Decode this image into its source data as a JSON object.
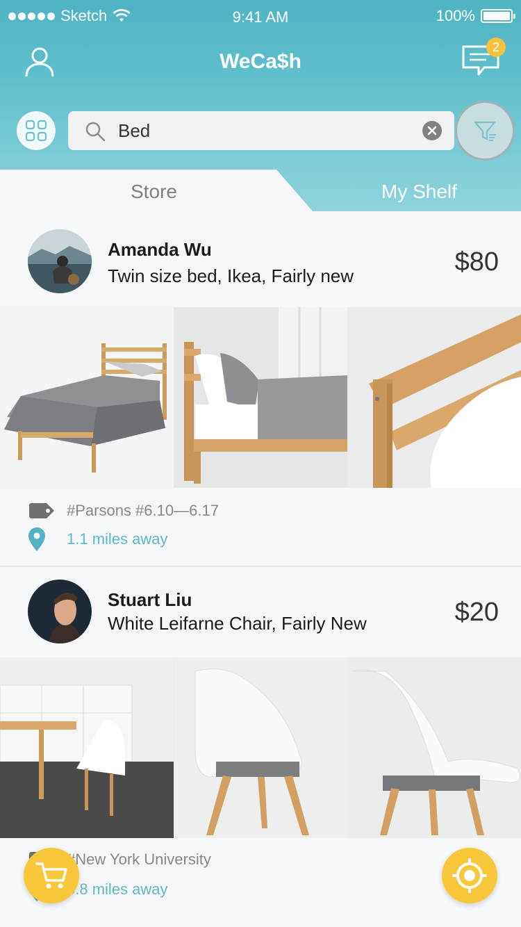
{
  "status_bar": {
    "carrier": "Sketch",
    "time": "9:41 AM",
    "battery": "100%"
  },
  "nav": {
    "title": "WeCa$h",
    "message_badge": "2"
  },
  "search": {
    "value": "Bed",
    "placeholder": "Search"
  },
  "tabs": [
    {
      "label": "Store",
      "active": true
    },
    {
      "label": "My Shelf",
      "active": false
    }
  ],
  "listings": [
    {
      "seller": "Amanda Wu",
      "description": "Twin size bed, Ikea, Fairly new",
      "price": "$80",
      "tags": "#Parsons  #6.10—6.17",
      "distance": "1.1 miles away",
      "photos": [
        "bed-front-photo",
        "bed-side-photo",
        "bed-headboard-closeup-photo"
      ]
    },
    {
      "seller": "Stuart Liu",
      "description": "White Leifarne Chair, Fairly New",
      "price": "$20",
      "tags": "#New York University",
      "distance": "0.8 miles away",
      "photos": [
        "chair-kitchen-photo",
        "chair-front-photo",
        "chair-side-photo"
      ]
    }
  ],
  "colors": {
    "header_teal": "#4fb3c3",
    "accent_yellow": "#f8c73a",
    "distance_teal": "#5fb8c7"
  }
}
